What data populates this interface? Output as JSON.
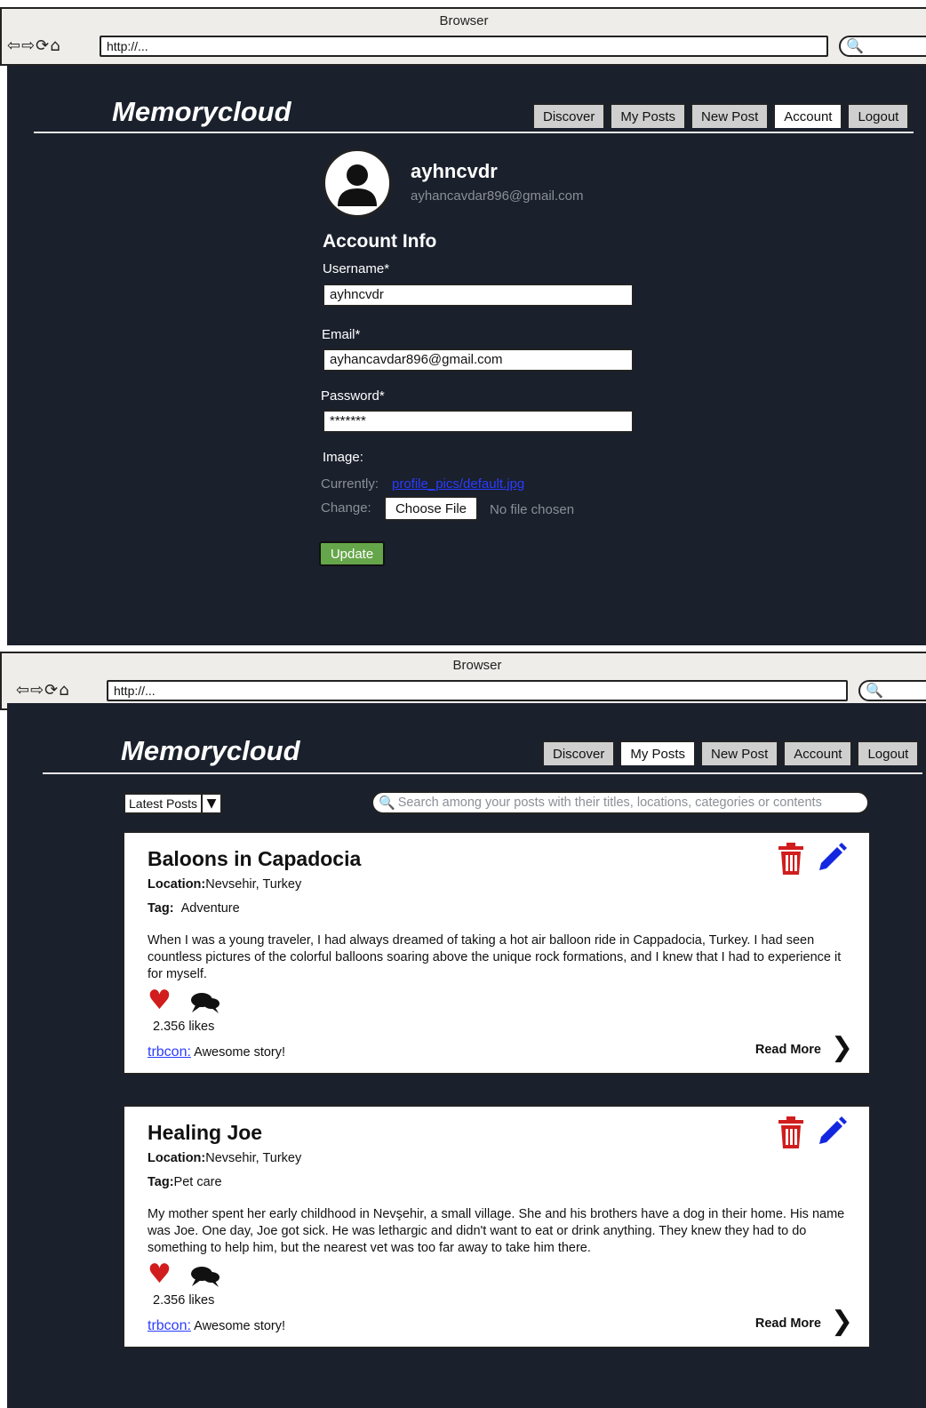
{
  "browser": {
    "title": "Browser",
    "url": "http://...",
    "nav_icons": "⇦⇨⟳⌂",
    "search_icon": "🔍"
  },
  "brand": {
    "logo": "Memorycloud"
  },
  "nav": {
    "discover": "Discover",
    "my_posts": "My Posts",
    "new_post": "New Post",
    "account": "Account",
    "logout": "Logout"
  },
  "account": {
    "username": "ayhncvdr",
    "email": "ayhancavdar896@gmail.com",
    "section_title": "Account Info",
    "username_label": "Username*",
    "username_value": "ayhncvdr",
    "email_label": "Email*",
    "email_value": "ayhancavdar896@gmail.com",
    "password_label": "Password*",
    "password_value": "*******",
    "image_label": "Image:",
    "currently_label": "Currently:",
    "currently_file": "profile_pics/default.jpg",
    "change_label": "Change:",
    "choose_file": "Choose File",
    "no_file": "No file chosen",
    "update_button": "Update"
  },
  "posts_page": {
    "sort_selected": "Latest Posts",
    "search_placeholder": "Search among your posts with their titles, locations, categories or contents"
  },
  "posts": [
    {
      "title": "Baloons in Capadocia",
      "location_label": "Location:",
      "location": "Nevsehir, Turkey",
      "tag_label": "Tag:",
      "tag": "Adventure",
      "body": "When I was a young traveler, I had always dreamed of taking a hot air balloon ride in Cappadocia, Turkey. I had seen countless pictures of the colorful balloons soaring above the unique rock formations, and I knew that I had to experience it for myself.",
      "likes": "2.356 likes",
      "comment_user": "trbcon:",
      "comment_text": "Awesome story!",
      "read_more": "Read More"
    },
    {
      "title": "Healing Joe",
      "location_label": "Location:",
      "location": "Nevsehir, Turkey",
      "tag_label": "Tag:",
      "tag": "Pet care",
      "body": "My mother spent her early childhood in Nevşehir, a small village. She and his brothers have a dog in their home. His name was Joe. One day, Joe got sick. He was lethargic and didn't want to eat or drink anything. They knew they had to do something to help him, but the nearest vet was too far away to take him there.",
      "likes": "2.356 likes",
      "comment_user": "trbcon:",
      "comment_text": "Awesome story!",
      "read_more": "Read More"
    }
  ],
  "colors": {
    "background": "#1a202c",
    "delete": "#d11d1d",
    "edit": "#1427e0",
    "update": "#66a64a",
    "link": "#2b3cff"
  }
}
